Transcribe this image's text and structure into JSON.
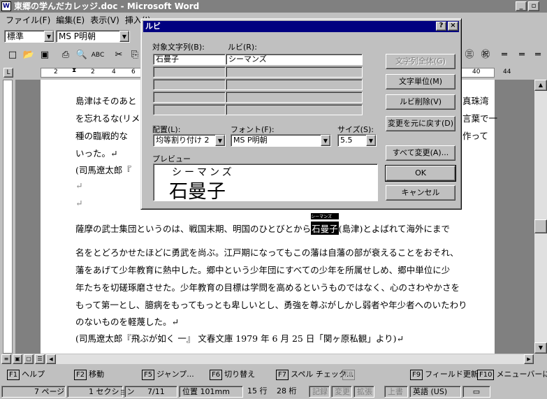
{
  "window": {
    "title": "東郷の学んだカレッジ.doc - Microsoft Word"
  },
  "menu": [
    "ファイル(F)",
    "編集(E)",
    "表示(V)",
    "挿入(I)"
  ],
  "format_toolbar": {
    "style": "標準",
    "font": "MS P明朝"
  },
  "ruler": {
    "numbers": [
      "2",
      "2",
      "4",
      "6",
      "40",
      "44"
    ]
  },
  "document": {
    "lines_top": [
      "島津はそのあと",
      "を忘れるな(リメ",
      "種の臨戦的な",
      "いった。↵",
      "(司馬遼太郎『",
      "↵",
      "↵"
    ],
    "right_fragments": [
      "真珠湾",
      "言葉で一",
      "作って"
    ],
    "para1_before": "薩摩の武士集団というのは、戦国末期、明国のひとびとから",
    "ruby_target": "石曼子",
    "ruby_small": "シーマンズ",
    "para1_after": "(島津)とよばれて海外にまで",
    "lines_bottom": [
      "名をとどろかせたほどに勇武を尚ぶ。江戸期になってもこの藩は自藩の部が衰えることをおそれ、",
      "藩をあげて少年教育に熱中した。郷中という少年団にすべての少年を所属せしめ、郷中単位に少",
      "年たちを切磋琢磨させた。少年教育の目標は学問を高めるというものではなく、心のさわやかさを",
      "もって第一とし、臆病をもってもっとも卑しいとし、勇強を尊ぶがしかし弱者や年少者へのいたわり",
      "のないものを軽蔑した。↵",
      "(司馬遼太郎『飛ぶが如く 一』 文春文庫 1979 年 6 月 25 日「関ヶ原私観」より)↵"
    ]
  },
  "dialog": {
    "title": "ルビ",
    "help_btn": "?",
    "close_btn": "×",
    "label_target": "対象文字列(B):",
    "label_ruby": "ルビ(R):",
    "target_value": "石曼子",
    "ruby_value": "シーマンズ",
    "label_align": "配置(L):",
    "align_value": "均等割り付け 2",
    "label_font": "フォント(F):",
    "font_value": "MS P明朝",
    "label_size": "サイズ(S):",
    "size_value": "5.5",
    "label_preview": "プレビュー",
    "preview_ruby": "シーマンズ",
    "preview_base": "石曼子",
    "buttons": {
      "all_text": "文字列全体(G)",
      "char_unit": "文字単位(M)",
      "delete_ruby": "ルビ削除(V)",
      "restore": "変更を元に戻す(D)",
      "change_all": "すべて変更(A)...",
      "ok": "OK",
      "cancel": "キャンセル"
    }
  },
  "fkeys": [
    {
      "key": "F1",
      "label": "ヘルプ"
    },
    {
      "key": "F2",
      "label": "移動"
    },
    {
      "key": "F5",
      "label": "ジャンプ..."
    },
    {
      "key": "F6",
      "label": "切り替え"
    },
    {
      "key": "F7",
      "label": "スペル チェック..."
    },
    {
      "key": "F8",
      "label": ""
    },
    {
      "key": "F9",
      "label": "フィールド更新"
    },
    {
      "key": "F10",
      "label": "メニューバーに..."
    }
  ],
  "status": {
    "page": "7 ページ",
    "section": "1 セクション",
    "count": "7/11",
    "position": "位置 101mm",
    "row": "15 行",
    "col": "28 桁",
    "rec": "記録",
    "trk": "変更",
    "ext": "拡張",
    "ovr": "上書",
    "lang": "英語 (US)"
  }
}
